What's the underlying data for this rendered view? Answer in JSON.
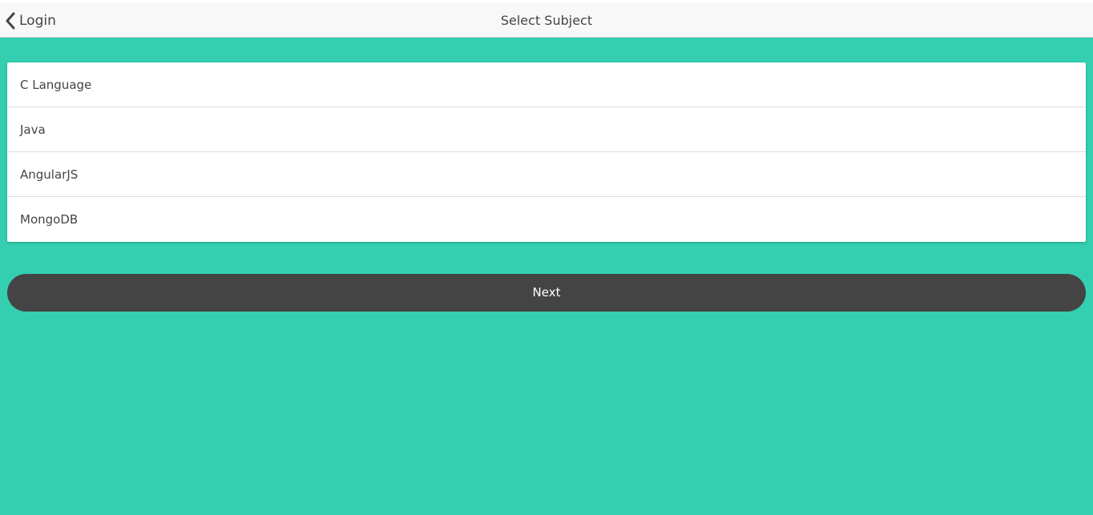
{
  "navbar": {
    "back_label": "Login",
    "back_icon": "chevron-left-icon",
    "title": "Select Subject"
  },
  "subjects": {
    "items": [
      {
        "label": "C Language"
      },
      {
        "label": "Java"
      },
      {
        "label": "AngularJS"
      },
      {
        "label": "MongoDB"
      }
    ]
  },
  "actions": {
    "next_label": "Next"
  },
  "colors": {
    "background": "#33cfb0",
    "navbar": "#f8f8f8",
    "button": "#444444",
    "text": "#444444"
  }
}
